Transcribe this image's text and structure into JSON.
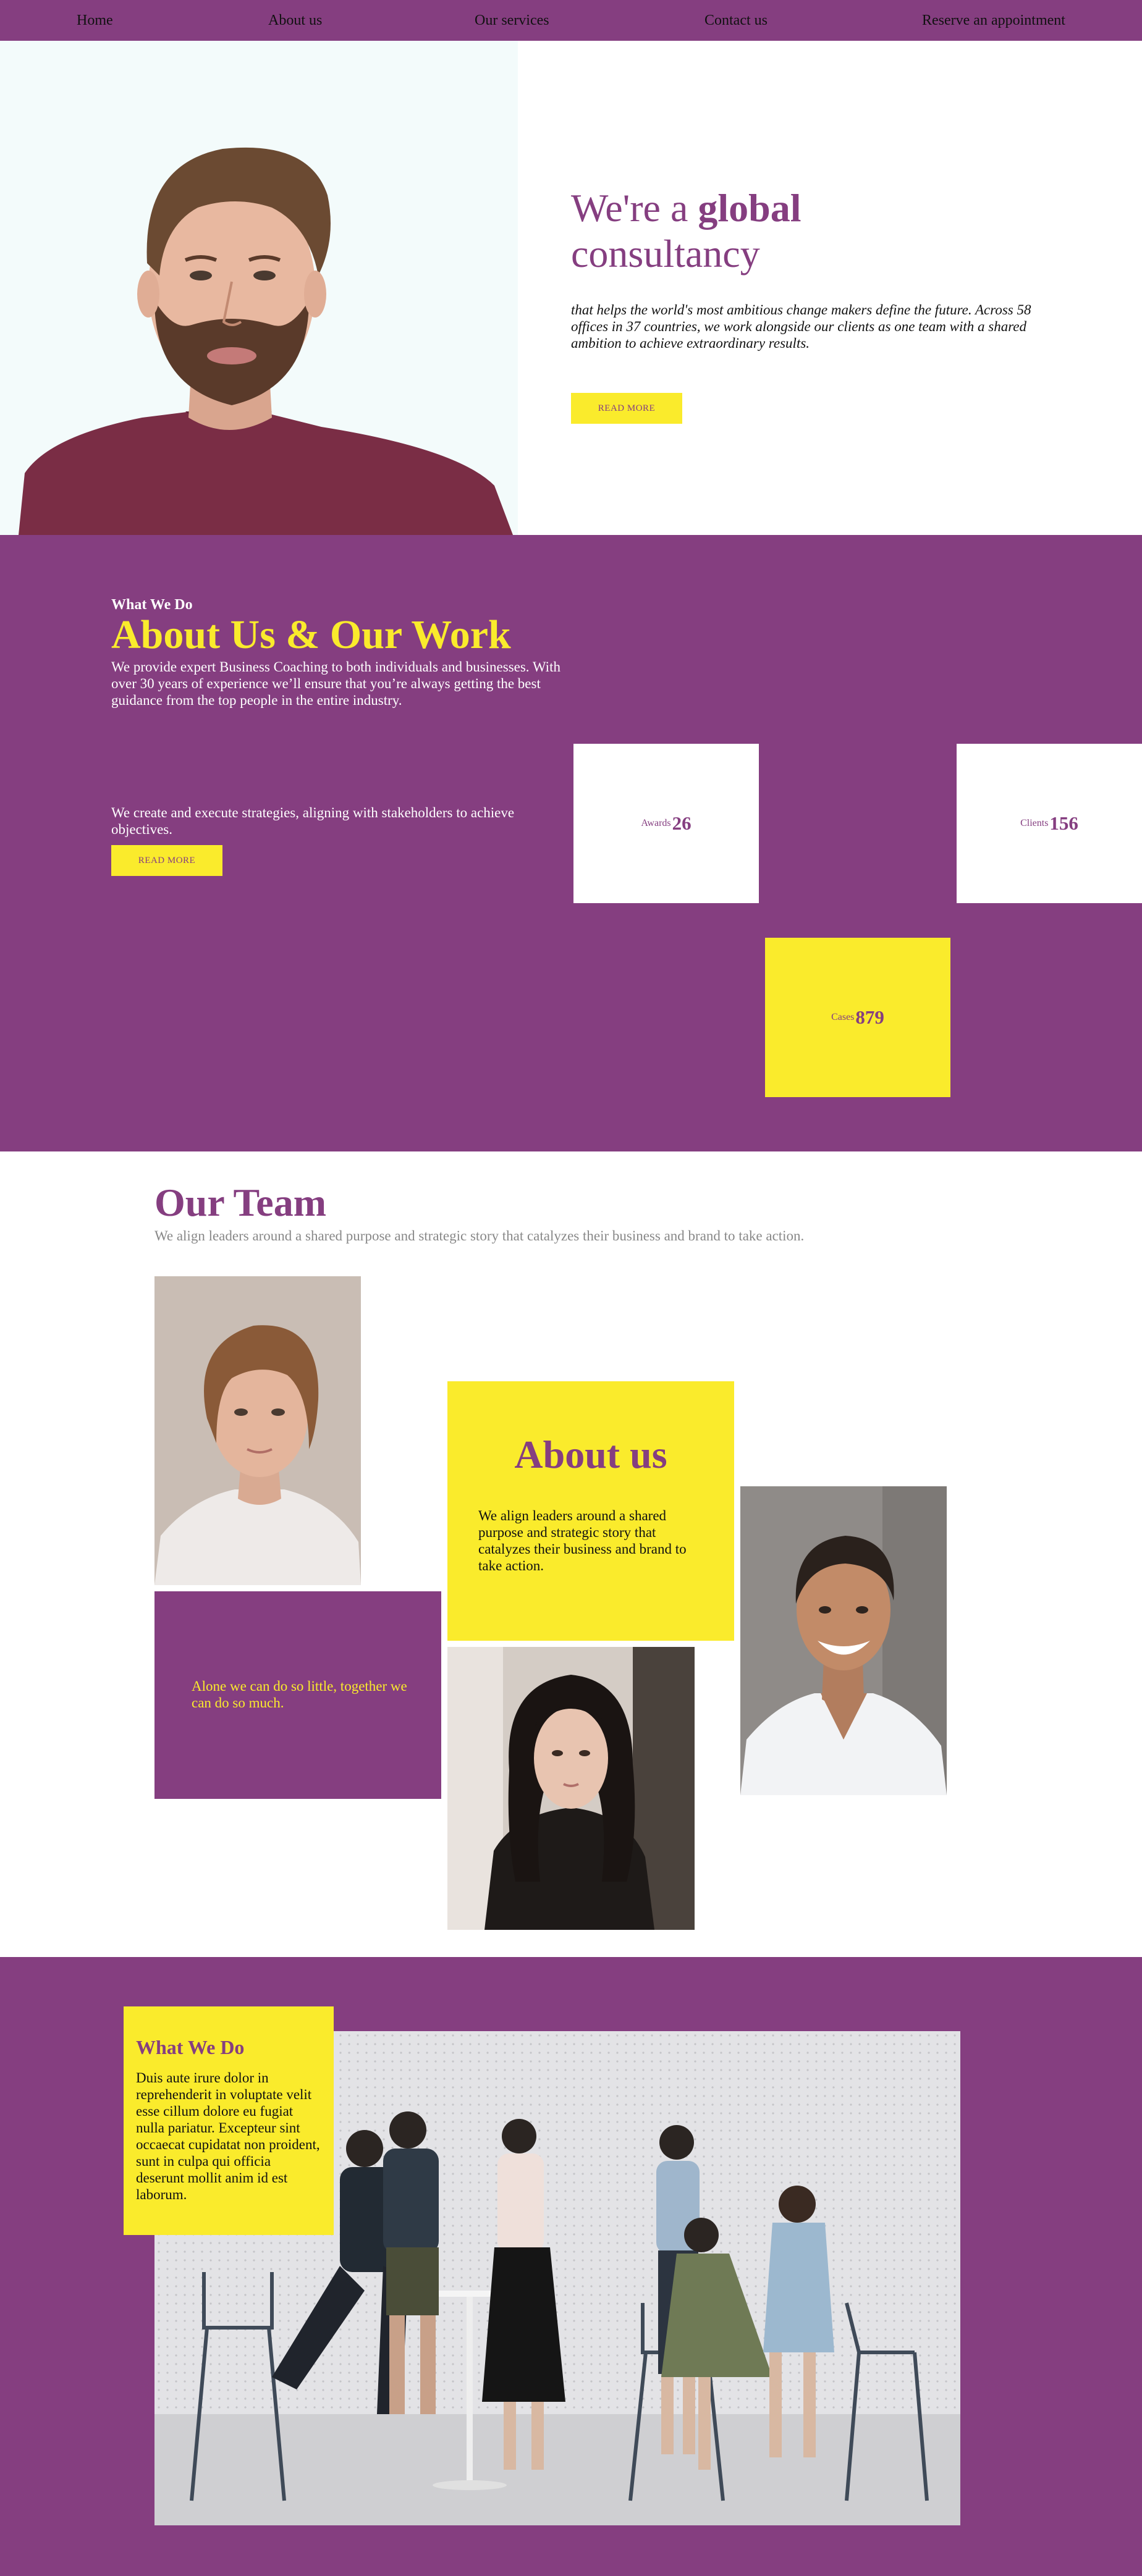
{
  "nav": {
    "items": [
      {
        "label": "Home"
      },
      {
        "label": "About us"
      },
      {
        "label": "Our services"
      },
      {
        "label": "Contact us"
      },
      {
        "label": "Reserve an appointment"
      }
    ]
  },
  "hero": {
    "title_pre": "We're a ",
    "title_bold": "global",
    "title_post": "consultancy",
    "subtitle": "that helps the world's most ambitious change makers define the future. Across 58 offices in 37 countries, we work alongside our clients as one team with a shared ambition to achieve extraordinary results.",
    "button": "READ MORE"
  },
  "work": {
    "kicker": "What We Do",
    "title": "About Us & Our Work",
    "paragraph1": "We provide expert Business Coaching to both individuals and businesses. With over 30 years of experience we’ll ensure that you’re always getting the best guidance from the top people in the entire industry.",
    "paragraph2": "We create and execute strategies, aligning with stakeholders to achieve objectives.",
    "button": "READ MORE",
    "stats": [
      {
        "label": "Awards",
        "value": "26"
      },
      {
        "label": "Clients",
        "value": "156"
      },
      {
        "label": "Cases",
        "value": "879"
      }
    ]
  },
  "team": {
    "title": "Our Team",
    "subtitle": "We align leaders around a shared purpose and strategic story that catalyzes their business and brand to take action.",
    "about_title": "About us",
    "about_text": "We align leaders around a shared purpose and strategic story that catalyzes their business and brand to take action.",
    "quote": "Alone we can do so little, together we can do so much."
  },
  "what": {
    "title": "What We Do",
    "text": "Duis aute irure dolor in reprehenderit in voluptate velit esse cillum dolore eu fugiat nulla pariatur. Excepteur sint occaecat cupidatat non proident, sunt in culpa qui officia deserunt mollit anim id est laborum."
  },
  "colors": {
    "purple": "#853e80",
    "yellow": "#faeb2c",
    "white": "#ffffff"
  }
}
